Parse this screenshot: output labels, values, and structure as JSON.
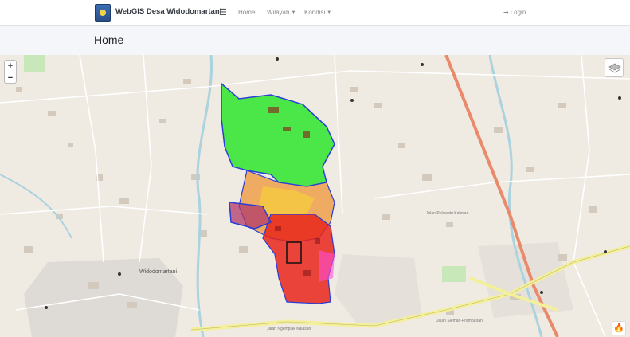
{
  "navbar": {
    "brand": "WebGIS Desa Widodomartani",
    "menu_icon": "hamburger-icon",
    "links": [
      {
        "label": "Home"
      },
      {
        "label": "Wilayah",
        "dropdown": true
      },
      {
        "label": "Kondisi",
        "dropdown": true
      }
    ],
    "login": "Login",
    "login_icon": "sign-in-icon"
  },
  "page": {
    "title": "Home"
  },
  "map": {
    "zoom_in": "+",
    "zoom_out": "−",
    "layers_icon": "layers-icon",
    "flame_icon": "flame-icon",
    "place_labels": [
      {
        "text": "Widodomartani"
      },
      {
        "text": "Jalan Ngemplak Kalasan"
      },
      {
        "text": "Jalan Sleman-Prambanan"
      },
      {
        "text": "Jalan Pulowatu Kalasan"
      }
    ],
    "colors": {
      "green_zone": "#2ee62e",
      "yellow_zone": "#f5c842",
      "orange_zone": "#f0a04b",
      "red_zone": "#e8261c",
      "boundary": "#2a3fd6",
      "main_road": "#e88a6b",
      "secondary_road": "#f3ef9a",
      "river": "#aad3df"
    }
  }
}
